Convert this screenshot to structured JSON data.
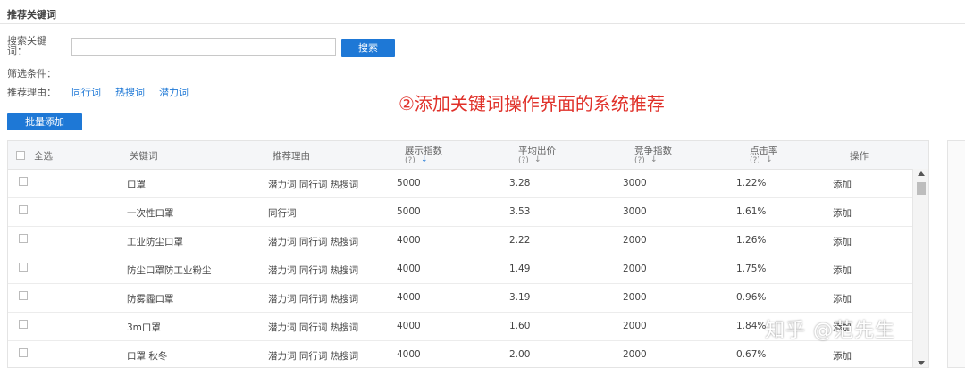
{
  "section_title": "推荐关键词",
  "search": {
    "label": "搜索关键\n词：",
    "value": "",
    "button": "搜索"
  },
  "filter_label": "筛选条件：",
  "reason": {
    "label": "推荐理由：",
    "options": [
      "同行词",
      "热搜词",
      "潜力词"
    ]
  },
  "annotation": "②添加关键词操作界面的系统推荐",
  "batch_add": "批量添加",
  "table": {
    "columns": {
      "select_all": "全选",
      "keyword": "关键词",
      "reason": "推荐理由",
      "display_index": "展示指数",
      "avg_bid": "平均出价",
      "competition": "竞争指数",
      "ctr": "点击率",
      "action": "操作"
    },
    "help_mark": "?",
    "sort_mark": "↓",
    "rows": [
      {
        "keyword": "口罩",
        "reason": "潜力词 同行词 热搜词",
        "display": "5000",
        "bid": "3.28",
        "comp": "3000",
        "ctr": "1.22%",
        "action": "添加"
      },
      {
        "keyword": "一次性口罩",
        "reason": "同行词",
        "display": "5000",
        "bid": "3.53",
        "comp": "3000",
        "ctr": "1.61%",
        "action": "添加"
      },
      {
        "keyword": "工业防尘口罩",
        "reason": "潜力词 同行词 热搜词",
        "display": "4000",
        "bid": "2.22",
        "comp": "2000",
        "ctr": "1.26%",
        "action": "添加"
      },
      {
        "keyword": "防尘口罩防工业粉尘",
        "reason": "潜力词 同行词 热搜词",
        "display": "4000",
        "bid": "1.49",
        "comp": "2000",
        "ctr": "1.75%",
        "action": "添加"
      },
      {
        "keyword": "防雾霾口罩",
        "reason": "潜力词 同行词 热搜词",
        "display": "4000",
        "bid": "3.19",
        "comp": "2000",
        "ctr": "0.96%",
        "action": "添加"
      },
      {
        "keyword": "3m口罩",
        "reason": "潜力词 同行词 热搜词",
        "display": "4000",
        "bid": "1.60",
        "comp": "2000",
        "ctr": "1.84%",
        "action": "添加"
      },
      {
        "keyword": "口罩 秋冬",
        "reason": "潜力词 同行词 热搜词",
        "display": "4000",
        "bid": "2.00",
        "comp": "2000",
        "ctr": "0.67%",
        "action": "添加"
      }
    ]
  },
  "watermark": "知乎 @范先生"
}
